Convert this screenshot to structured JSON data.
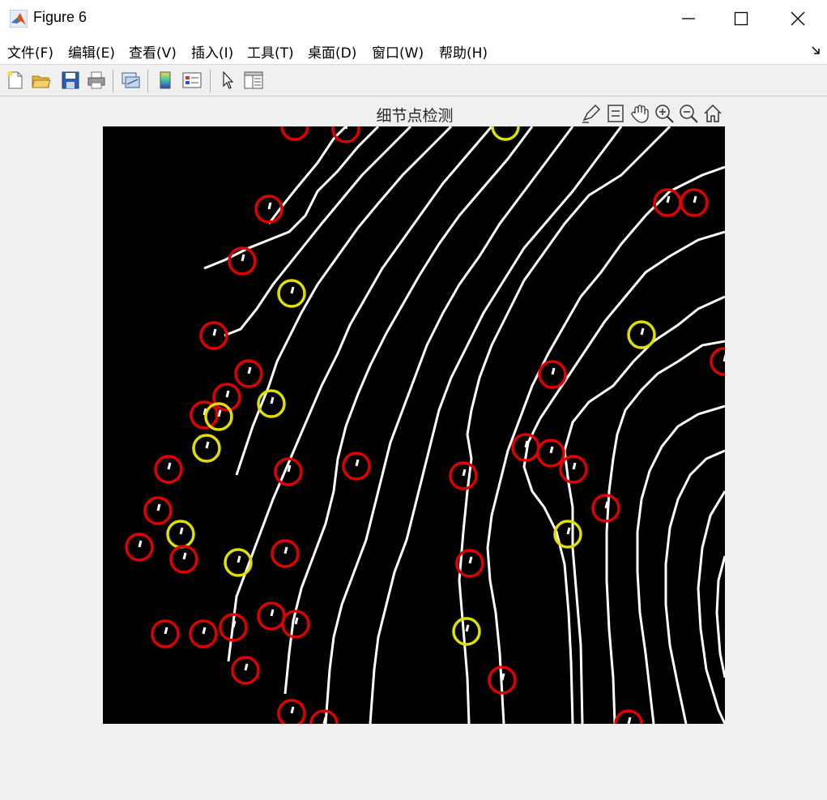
{
  "window": {
    "title": "Figure 6",
    "controls": [
      "minimize",
      "maximize",
      "close"
    ]
  },
  "menu": {
    "items": [
      "文件(F)",
      "编辑(E)",
      "查看(V)",
      "插入(I)",
      "工具(T)",
      "桌面(D)",
      "窗口(W)",
      "帮助(H)"
    ]
  },
  "toolbar": {
    "buttons": [
      "new-figure-icon",
      "open-file-icon",
      "save-icon",
      "print-icon",
      "link-plot-icon",
      "colorbar-icon",
      "legend-icon",
      "edit-plot-cursor-icon",
      "property-inspector-icon"
    ]
  },
  "axes_toolbar": {
    "buttons": [
      "brush-icon",
      "datatips-icon",
      "pan-hand-icon",
      "zoom-in-icon",
      "zoom-out-icon",
      "home-icon"
    ]
  },
  "plot": {
    "title": "细节点检测",
    "image": "binary fingerprint ridge skeleton",
    "colors": {
      "background": "#000000",
      "ridge": "#ffffff",
      "ending_marker": "#e00000",
      "bifurcation_marker": "#e0e000"
    },
    "minutiae_markers": [
      "ending",
      "bifurcation"
    ]
  }
}
